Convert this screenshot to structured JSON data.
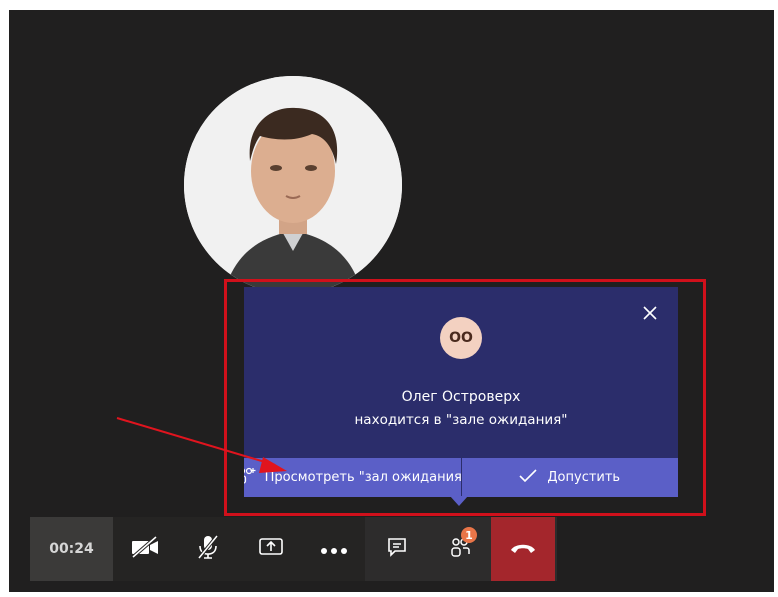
{
  "lobby_notification": {
    "initials": "ОО",
    "name": "Олег Островерх",
    "status": "находится в \"зале ожидания\"",
    "view_lobby_label": "Просмотреть \"зал ожидания\"",
    "admit_label": "Допустить"
  },
  "call_controls": {
    "timer": "00:24",
    "participants_badge": "1"
  },
  "icons": [
    "close-icon",
    "people-add-icon",
    "check-icon",
    "video-off-icon",
    "mic-off-icon",
    "share-screen-icon",
    "more-icon",
    "chat-icon",
    "participants-icon",
    "hang-up-icon",
    "arrow-annotation-icon"
  ],
  "colors": {
    "stage_bg": "#201f1f",
    "popup_bg": "#2b2d6b",
    "popup_actions_bg": "#5b5fc7",
    "highlight": "#d0101b",
    "hangup": "#a4262c",
    "badge": "#e97548"
  }
}
